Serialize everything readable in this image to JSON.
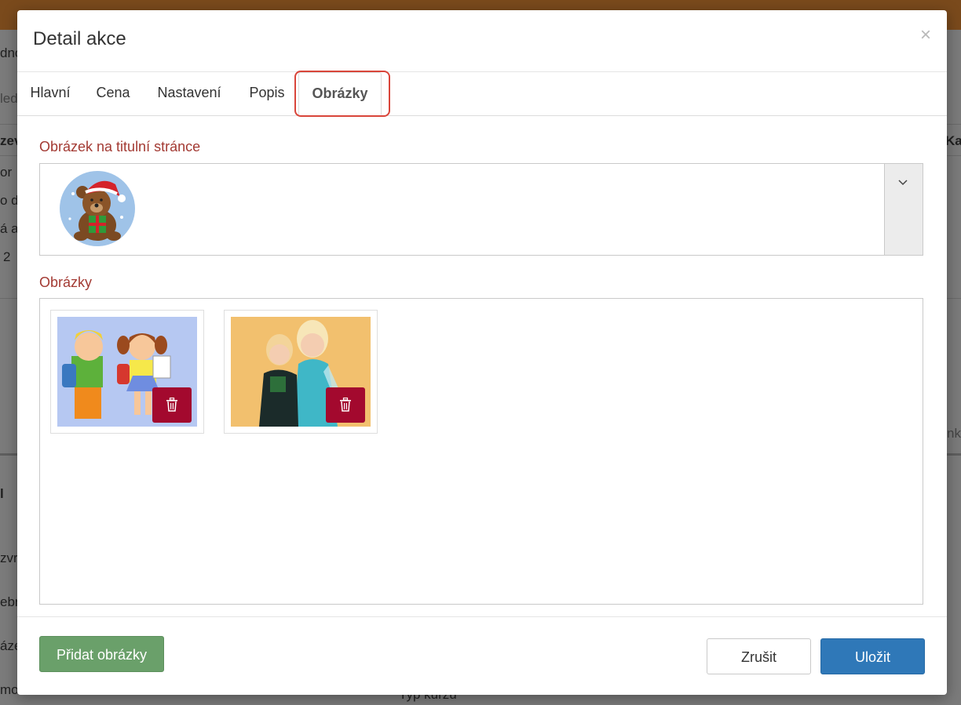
{
  "background": {
    "fragments": [
      {
        "text": "dno"
      },
      {
        "text": "led"
      },
      {
        "text": "zev"
      },
      {
        "text": "or"
      },
      {
        "text": "o dů"
      },
      {
        "text": "á a"
      },
      {
        "text": "2"
      },
      {
        "text": "Ka"
      },
      {
        "text": "l"
      },
      {
        "text": "zvr"
      },
      {
        "text": "ebr"
      },
      {
        "text": "áze"
      },
      {
        "text": "mot"
      },
      {
        "text": "nk"
      },
      {
        "text": "Typ kurzu"
      }
    ]
  },
  "modal": {
    "title": "Detail akce",
    "close_symbol": "×",
    "tabs": [
      {
        "label": "Hlavní"
      },
      {
        "label": "Cena"
      },
      {
        "label": "Nastavení"
      },
      {
        "label": "Popis"
      },
      {
        "label": "Obrázky",
        "active": true
      }
    ],
    "title_image_section": {
      "label": "Obrázek na titulní stránce",
      "selected_image": "teddy-bear-santa-hat-icon"
    },
    "images_section": {
      "label": "Obrázky",
      "images": [
        {
          "name": "cartoon-school-children-image"
        },
        {
          "name": "two-girls-costumes-photo"
        }
      ]
    },
    "footer": {
      "add_images_label": "Přidat obrázky",
      "cancel_label": "Zrušit",
      "save_label": "Uložit"
    },
    "colors": {
      "section_label": "#a33a33",
      "delete_button": "#a3092e",
      "add_button": "#6aa06a",
      "save_button": "#2f78b8",
      "tab_highlight": "#d9453a"
    }
  }
}
